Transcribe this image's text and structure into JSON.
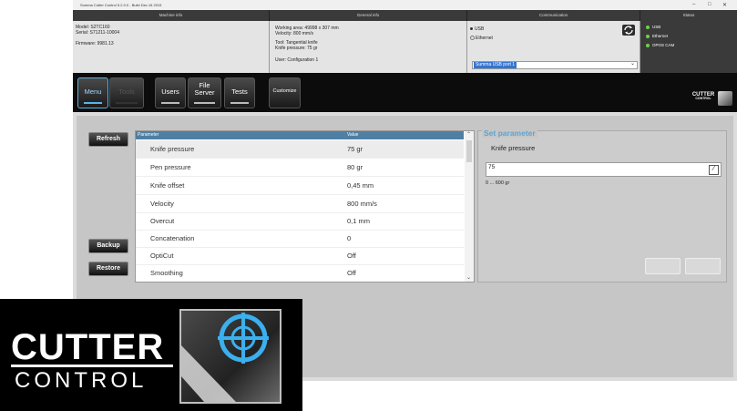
{
  "window": {
    "title": "Summa Cutter Control 5.2.0.0 - Build Dec 16 2015",
    "controls": [
      "–",
      "□",
      "✕"
    ]
  },
  "headers": [
    "Machine info",
    "General info",
    "Communication",
    "Status"
  ],
  "machine_info": {
    "model": "Model: S2TC160",
    "serial": "Serial: S71211-10004",
    "firmware": "Firmware: 9981.13"
  },
  "general_info": {
    "working_area": "Working area: 49998 x 307 mm",
    "velocity": "Velocity: 800 mm/s",
    "tool": "Tool: Tangential knife",
    "knife_pressure": "Knife pressure: 75 gr",
    "user": "User: Configuration 1"
  },
  "communication": {
    "usb_label": "USB",
    "ethernet_label": "Ethernet",
    "port_value": "Summa USB port 1",
    "refresh_icon": "refresh-icon"
  },
  "status": {
    "items": [
      {
        "label": "USB",
        "color": "#6fd14a"
      },
      {
        "label": "Ethernet",
        "color": "#6fd14a"
      },
      {
        "label": "OPOS CAM",
        "color": "#6fd14a"
      }
    ]
  },
  "nav": {
    "menu": "Menu",
    "tools": "Tools",
    "users": "Users",
    "file_server_1": "File",
    "file_server_2": "Server",
    "tests": "Tests",
    "customize": "Customize"
  },
  "logo_small": {
    "line1": "CUTTER",
    "line2": "CONTROL"
  },
  "side_buttons": {
    "refresh": "Refresh",
    "backup": "Backup",
    "restore": "Restore"
  },
  "table": {
    "col_param": "Parameter",
    "col_value": "Value",
    "rows": [
      {
        "param": "Knife pressure",
        "value": "75 gr"
      },
      {
        "param": "Pen pressure",
        "value": "80 gr"
      },
      {
        "param": "Knife offset",
        "value": "0,45 mm"
      },
      {
        "param": "Velocity",
        "value": "800 mm/s"
      },
      {
        "param": "Overcut",
        "value": "0,1 mm"
      },
      {
        "param": "Concatenation",
        "value": "0"
      },
      {
        "param": "OptiCut",
        "value": "Off"
      },
      {
        "param": "Smoothing",
        "value": "Off"
      }
    ]
  },
  "set_parameter": {
    "title": "Set parameter",
    "name": "Knife pressure",
    "value": "75",
    "range": "0 ... 600 gr"
  },
  "brand": {
    "line1": "CUTTER",
    "line2": "CONTROL"
  },
  "colors": {
    "accent": "#5ab4e8",
    "table_header": "#4f7fa3",
    "status_ok": "#6fd14a"
  }
}
